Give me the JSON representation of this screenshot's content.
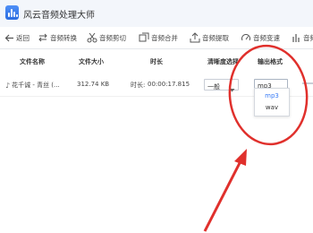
{
  "app": {
    "title": "风云音频处理大师",
    "accent": "#3a7cf6",
    "annotation_color": "#e0302c"
  },
  "toolbar": {
    "back_label": "返回",
    "items": [
      {
        "label": "音频转换",
        "icon": "swap-arrows-icon"
      },
      {
        "label": "音频剪切",
        "icon": "scissors-icon"
      },
      {
        "label": "音频合并",
        "icon": "merge-squares-icon"
      },
      {
        "label": "音频提取",
        "icon": "upload-tray-icon"
      },
      {
        "label": "音频变速",
        "icon": "speed-dial-icon"
      },
      {
        "label": "音频",
        "icon": "equalizer-bars-icon"
      }
    ]
  },
  "table": {
    "headers": [
      "文件名称",
      "文件大小",
      "时长",
      "清晰度选择",
      "输出格式"
    ],
    "rows": [
      {
        "name": "花千诚 - 青丝 (...",
        "size": "312.74 KB",
        "duration_label": "时长:",
        "duration": "00:00:17.815",
        "quality": "一般",
        "format": "mp3"
      }
    ]
  },
  "format_dropdown": {
    "options": [
      "mp3",
      "wav"
    ],
    "selected": "mp3"
  }
}
